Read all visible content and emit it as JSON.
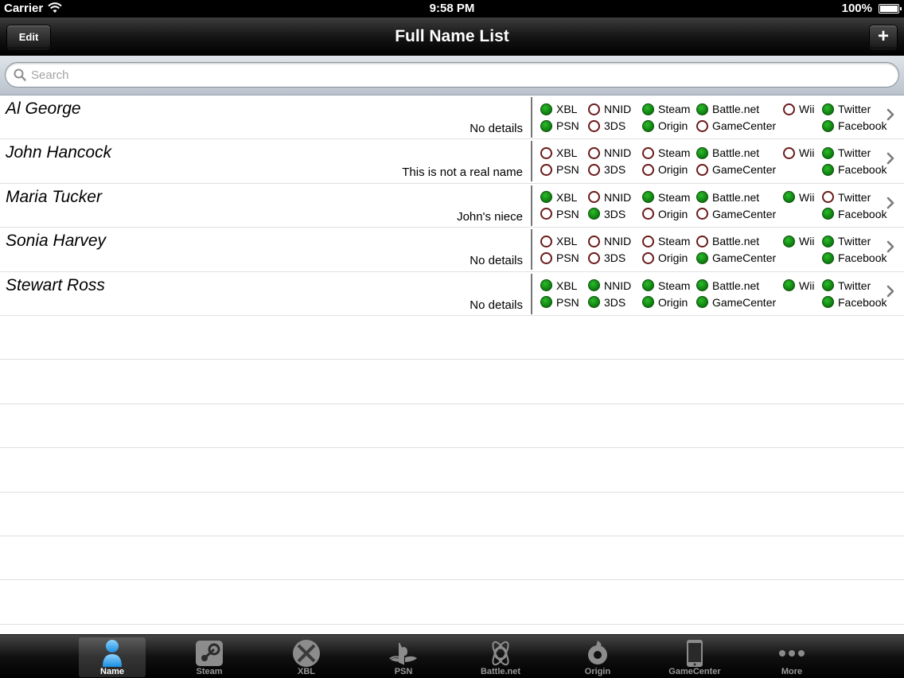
{
  "status": {
    "carrier": "Carrier",
    "time": "9:58 PM",
    "battery": "100%"
  },
  "nav": {
    "title": "Full Name List",
    "edit_label": "Edit",
    "add_label": "+"
  },
  "search": {
    "placeholder": "Search"
  },
  "services": [
    "XBL",
    "NNID",
    "Steam",
    "Battle.net",
    "Wii",
    "Twitter",
    "PSN",
    "3DS",
    "Origin",
    "GameCenter",
    "Facebook"
  ],
  "rows": [
    {
      "name": "Al George",
      "details": "No details",
      "status": {
        "XBL": true,
        "NNID": false,
        "Steam": true,
        "Battle.net": true,
        "Wii": false,
        "Twitter": true,
        "PSN": true,
        "3DS": false,
        "Origin": true,
        "GameCenter": false,
        "Facebook": true
      }
    },
    {
      "name": "John Hancock",
      "details": "This is not a real name",
      "status": {
        "XBL": false,
        "NNID": false,
        "Steam": false,
        "Battle.net": true,
        "Wii": false,
        "Twitter": true,
        "PSN": false,
        "3DS": false,
        "Origin": false,
        "GameCenter": false,
        "Facebook": true
      }
    },
    {
      "name": "Maria Tucker",
      "details": "John's niece",
      "status": {
        "XBL": true,
        "NNID": false,
        "Steam": true,
        "Battle.net": true,
        "Wii": true,
        "Twitter": false,
        "PSN": false,
        "3DS": true,
        "Origin": false,
        "GameCenter": false,
        "Facebook": true
      }
    },
    {
      "name": "Sonia Harvey",
      "details": "No details",
      "status": {
        "XBL": false,
        "NNID": false,
        "Steam": false,
        "Battle.net": false,
        "Wii": true,
        "Twitter": true,
        "PSN": false,
        "3DS": false,
        "Origin": false,
        "GameCenter": true,
        "Facebook": true
      }
    },
    {
      "name": "Stewart Ross",
      "details": "No details",
      "status": {
        "XBL": true,
        "NNID": true,
        "Steam": true,
        "Battle.net": true,
        "Wii": true,
        "Twitter": true,
        "PSN": true,
        "3DS": true,
        "Origin": true,
        "GameCenter": true,
        "Facebook": true
      }
    }
  ],
  "tabs": [
    {
      "label": "Name",
      "icon": "person-icon",
      "active": true
    },
    {
      "label": "Steam",
      "icon": "steam-icon",
      "active": false
    },
    {
      "label": "XBL",
      "icon": "xbox-icon",
      "active": false
    },
    {
      "label": "PSN",
      "icon": "playstation-icon",
      "active": false
    },
    {
      "label": "Battle.net",
      "icon": "battlenet-icon",
      "active": false
    },
    {
      "label": "Origin",
      "icon": "origin-icon",
      "active": false
    },
    {
      "label": "GameCenter",
      "icon": "device-icon",
      "active": false
    },
    {
      "label": "More",
      "icon": "more-icon",
      "active": false
    }
  ],
  "colors": {
    "on": "#0f8a0f",
    "off_ring": "#6b1a1a",
    "tab_active": "#ffffff",
    "tab_inactive": "#999999"
  }
}
